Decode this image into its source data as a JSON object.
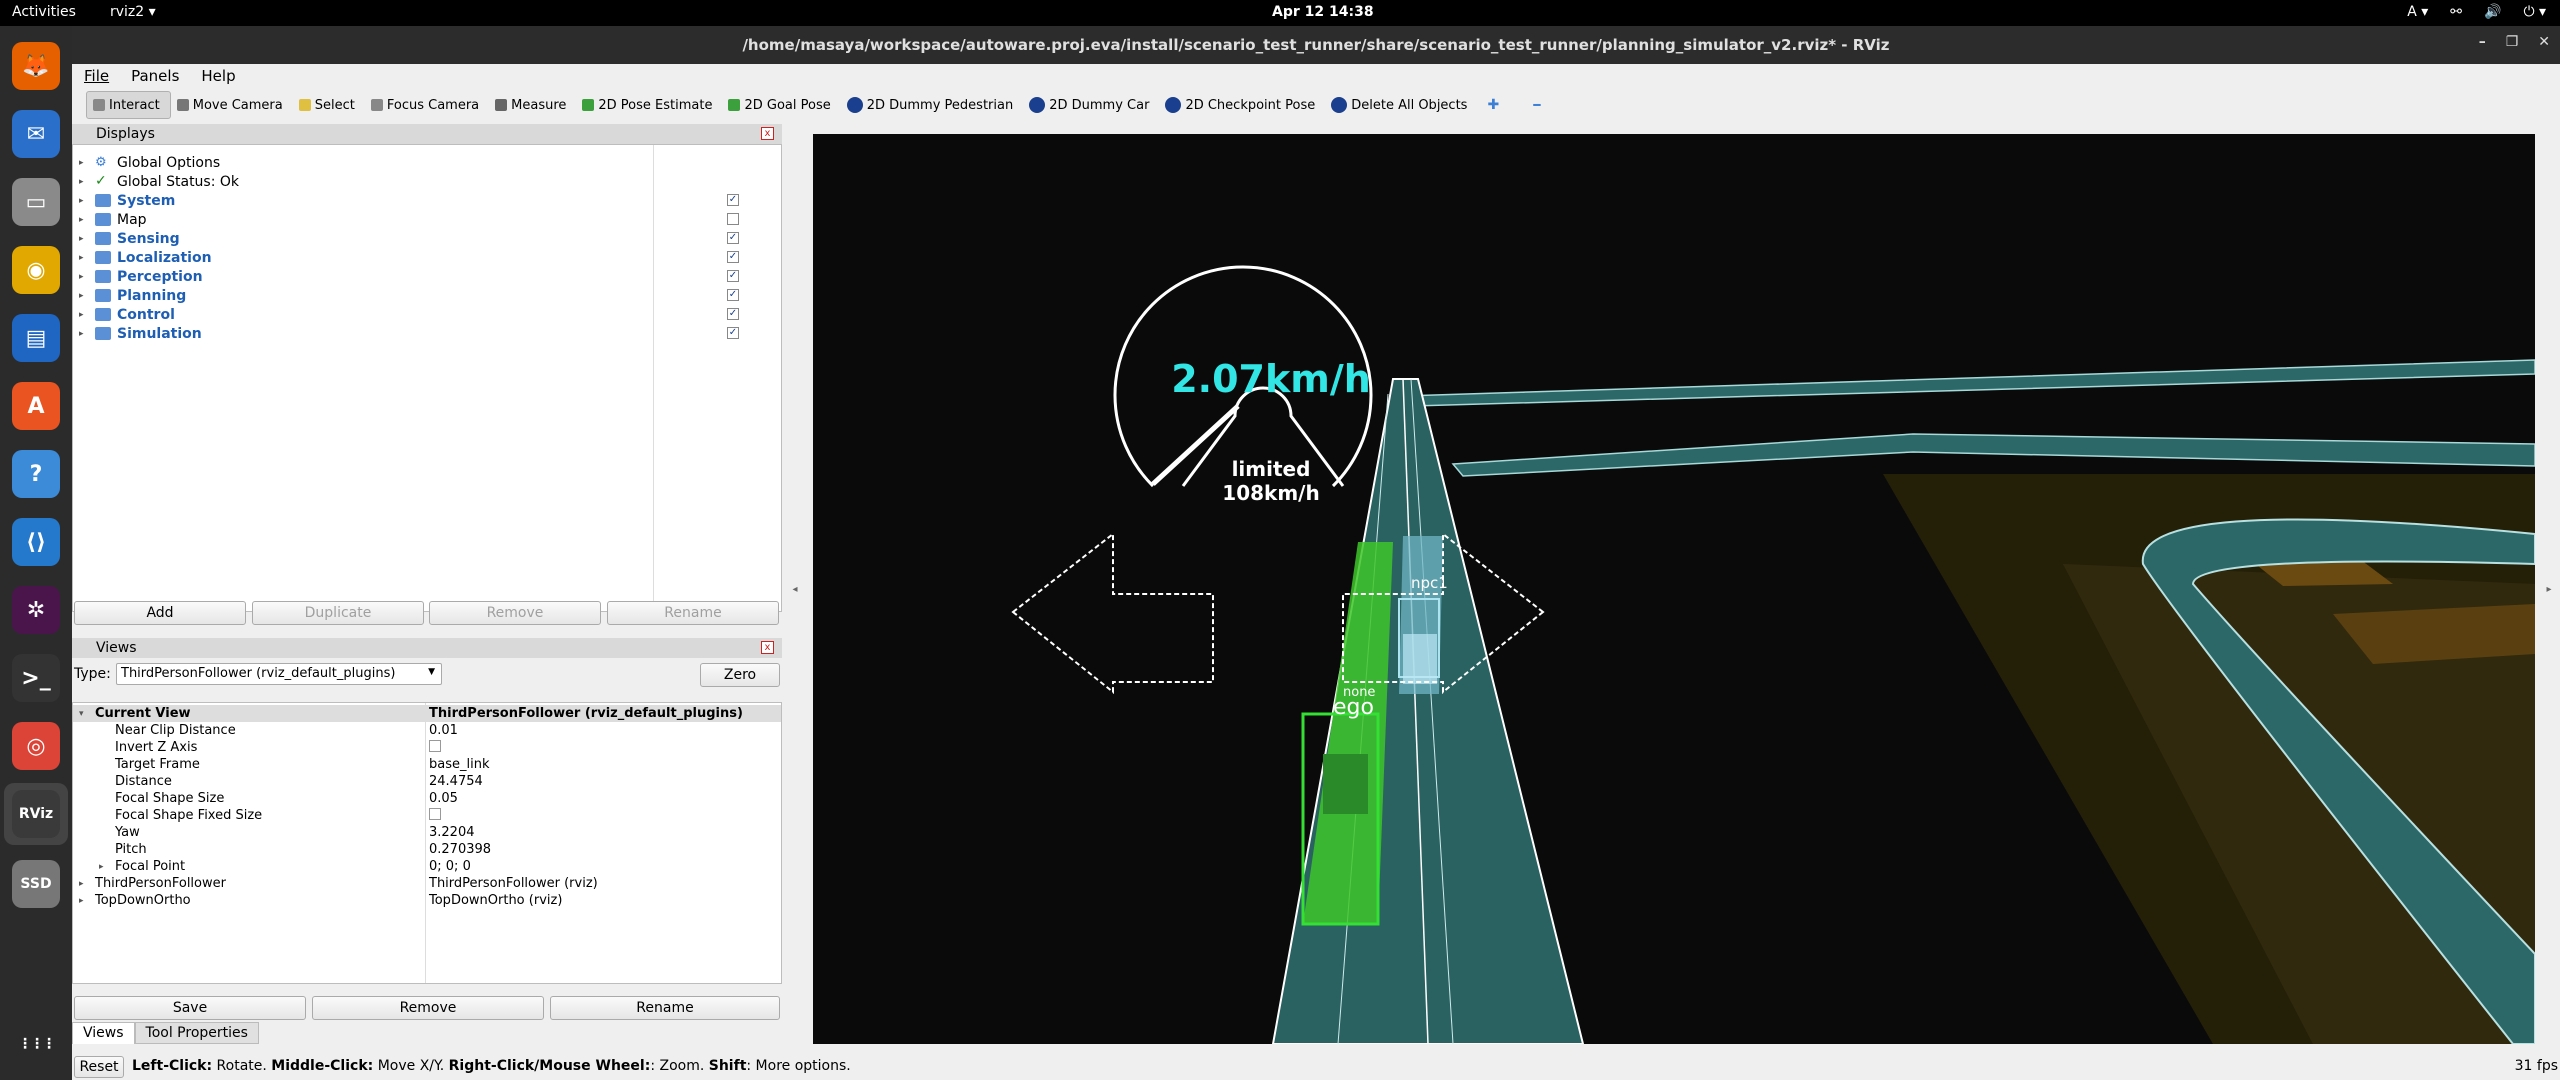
{
  "topbar": {
    "activities": "Activities",
    "app_name": "rviz2 ▾",
    "clock": "Apr 12  14:38",
    "tray": [
      "A ▾",
      "⚯",
      "🔊",
      "⏻ ▾"
    ]
  },
  "dock": {
    "apps": [
      {
        "name": "firefox-icon",
        "glyph": "🦊",
        "bg": "#e66000"
      },
      {
        "name": "thunderbird-icon",
        "glyph": "✉",
        "bg": "#2a6fc9"
      },
      {
        "name": "files-icon",
        "glyph": "▭",
        "bg": "#8a8a8a"
      },
      {
        "name": "rhythmbox-icon",
        "glyph": "◉",
        "bg": "#e0a800"
      },
      {
        "name": "writer-icon",
        "glyph": "▤",
        "bg": "#1f66c2"
      },
      {
        "name": "software-icon",
        "glyph": "A",
        "bg": "#e95420"
      },
      {
        "name": "help-icon",
        "glyph": "?",
        "bg": "#3c8bd9"
      },
      {
        "name": "vscode-icon",
        "glyph": "⟨⟩",
        "bg": "#2479cc"
      },
      {
        "name": "slack-icon",
        "glyph": "✲",
        "bg": "#4a154b"
      },
      {
        "name": "terminal-icon",
        "glyph": ">_",
        "bg": "#333"
      },
      {
        "name": "chrome-icon",
        "glyph": "◎",
        "bg": "#db4437"
      },
      {
        "name": "rviz-icon",
        "glyph": "RViz",
        "bg": "#3a3a3a"
      },
      {
        "name": "ssd-icon",
        "glyph": "SSD",
        "bg": "#777"
      }
    ],
    "show_apps": "⋮⋮⋮"
  },
  "window": {
    "title": "/home/masaya/workspace/autoware.proj.eva/install/scenario_test_runner/share/scenario_test_runner/planning_simulator_v2.rviz* - RViz",
    "controls": [
      "–",
      "❐",
      "✕"
    ]
  },
  "menu": [
    "File",
    "Panels",
    "Help"
  ],
  "toolbar": [
    {
      "label": "Interact",
      "active": true
    },
    {
      "label": "Move Camera"
    },
    {
      "label": "Select"
    },
    {
      "label": "Focus Camera"
    },
    {
      "label": "Measure"
    },
    {
      "label": "2D Pose Estimate"
    },
    {
      "label": "2D Goal Pose"
    },
    {
      "label": "2D Dummy Pedestrian"
    },
    {
      "label": "2D Dummy Car"
    },
    {
      "label": "2D Checkpoint Pose"
    },
    {
      "label": "Delete All Objects"
    }
  ],
  "displays": {
    "header": "Displays",
    "items": [
      {
        "label": "Global Options",
        "type": "gear",
        "check": null,
        "blue": false
      },
      {
        "label": "Global Status: Ok",
        "type": "ok",
        "check": null,
        "blue": false
      },
      {
        "label": "System",
        "type": "folder",
        "check": true,
        "blue": true
      },
      {
        "label": "Map",
        "type": "folder",
        "check": false,
        "blue": false
      },
      {
        "label": "Sensing",
        "type": "folder",
        "check": true,
        "blue": true
      },
      {
        "label": "Localization",
        "type": "folder",
        "check": true,
        "blue": true
      },
      {
        "label": "Perception",
        "type": "folder",
        "check": true,
        "blue": true
      },
      {
        "label": "Planning",
        "type": "folder",
        "check": true,
        "blue": true
      },
      {
        "label": "Control",
        "type": "folder",
        "check": true,
        "blue": true
      },
      {
        "label": "Simulation",
        "type": "folder",
        "check": true,
        "blue": true
      }
    ],
    "buttons": {
      "add": "Add",
      "duplicate": "Duplicate",
      "remove": "Remove",
      "rename": "Rename"
    }
  },
  "views": {
    "header": "Views",
    "type_label": "Type:",
    "type_value": "ThirdPersonFollower (rviz_default_plugins)",
    "zero": "Zero",
    "current_view": {
      "key": "Current View",
      "value": "ThirdPersonFollower (rviz_default_plugins)"
    },
    "props": [
      {
        "key": "Near Clip Distance",
        "value": "0.01"
      },
      {
        "key": "Invert Z Axis",
        "value": "",
        "checkbox": true
      },
      {
        "key": "Target Frame",
        "value": "base_link"
      },
      {
        "key": "Distance",
        "value": "24.4754"
      },
      {
        "key": "Focal Shape Size",
        "value": "0.05"
      },
      {
        "key": "Focal Shape Fixed Size",
        "value": "",
        "checkbox": true
      },
      {
        "key": "Yaw",
        "value": "3.2204"
      },
      {
        "key": "Pitch",
        "value": "0.270398"
      },
      {
        "key": "Focal Point",
        "value": "0; 0; 0",
        "expandable": true
      }
    ],
    "saved": [
      {
        "key": "ThirdPersonFollower",
        "value": "ThirdPersonFollower (rviz)"
      },
      {
        "key": "TopDownOrtho",
        "value": "TopDownOrtho (rviz)"
      }
    ],
    "buttons": {
      "save": "Save",
      "remove": "Remove",
      "rename": "Rename"
    }
  },
  "tabs": [
    "Views",
    "Tool Properties"
  ],
  "status": {
    "reset": "Reset",
    "hint_bold_1": "Left-Click:",
    "hint_1": " Rotate. ",
    "hint_bold_2": "Middle-Click:",
    "hint_2": " Move X/Y. ",
    "hint_bold_3": "Right-Click/Mouse Wheel:",
    "hint_3": ": Zoom. ",
    "hint_bold_4": "Shift",
    "hint_4": ": More options.",
    "fps": "31 fps"
  },
  "viewport": {
    "speed": "2.07km/h",
    "limit_label": "limited",
    "limit_value": "108km/h",
    "ego_label": "ego",
    "ego_state": "none",
    "npc_label": "npc1",
    "colors": {
      "accent": "#33e6e6",
      "ego": "#3cd61e",
      "road": "#2f6a6a"
    }
  }
}
